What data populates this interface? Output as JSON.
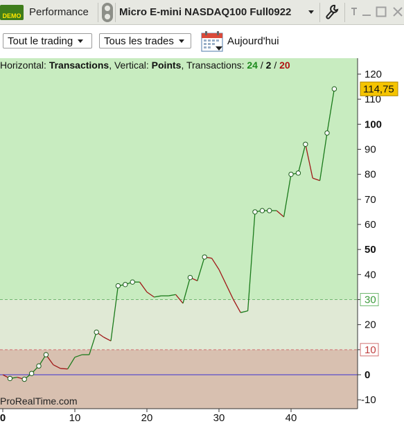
{
  "titlebar": {
    "demo_label": "DEMO",
    "app_name": "Performance",
    "instrument": "Micro E-mini NASDAQ100 Full0922"
  },
  "toolbar": {
    "filter1": "Tout le trading",
    "filter2": "Tous les trades",
    "date_label": "Aujourd'hui"
  },
  "info": {
    "horizontal_label": "Horizontal:",
    "horizontal_value": "Transactions",
    "vertical_label": ", Vertical:",
    "vertical_value": "Points",
    "transactions_label": ", Transactions:",
    "total": "24",
    "sep1": " / ",
    "losers": "2",
    "sep2": " / ",
    "winners": "20"
  },
  "watermark": "ProRealTime.com",
  "colors": {
    "up_line": "#1a7a1a",
    "down_line": "#a01818",
    "profit_zone": "#c8ecc0",
    "neutral_zone": "#e0e9d5",
    "loss_zone": "#d8c0b0",
    "price_tag": "#f5c400"
  },
  "chart_data": {
    "type": "line",
    "x_ticks": [
      "0",
      "10",
      "20",
      "30",
      "40"
    ],
    "y_ticks": [
      "-10",
      "0",
      "10",
      "20",
      "30",
      "40",
      "50",
      "60",
      "70",
      "80",
      "90",
      "100",
      "110",
      "120"
    ],
    "bold_y_ticks": [
      "0",
      "50",
      "100"
    ],
    "xlim": [
      0,
      49.5
    ],
    "ylim": [
      -13,
      122
    ],
    "threshold_low": 10,
    "threshold_high": 30,
    "zero_line": 0,
    "last_value_label": "114,75",
    "series": [
      {
        "points": [
          {
            "x": 0,
            "y": 0
          },
          {
            "x": 1,
            "y": -1.5,
            "m": true
          },
          {
            "x": 2,
            "y": -1
          },
          {
            "x": 3,
            "y": -1.8,
            "m": true
          },
          {
            "x": 4,
            "y": 0.5,
            "m": true
          },
          {
            "x": 5,
            "y": 3.5,
            "m": true
          },
          {
            "x": 6,
            "y": 8,
            "m": true
          },
          {
            "x": 7,
            "y": 4
          },
          {
            "x": 8,
            "y": 2.5
          },
          {
            "x": 9,
            "y": 2.3
          },
          {
            "x": 10,
            "y": 7
          },
          {
            "x": 11,
            "y": 8
          },
          {
            "x": 12,
            "y": 8
          },
          {
            "x": 13,
            "y": 17,
            "m": true
          },
          {
            "x": 14,
            "y": 15
          },
          {
            "x": 15,
            "y": 13.5
          },
          {
            "x": 16,
            "y": 35.5,
            "m": true
          },
          {
            "x": 17,
            "y": 36,
            "m": true
          },
          {
            "x": 18,
            "y": 37,
            "m": true
          },
          {
            "x": 19,
            "y": 37
          },
          {
            "x": 20,
            "y": 33
          },
          {
            "x": 21,
            "y": 31
          },
          {
            "x": 22,
            "y": 31.5
          },
          {
            "x": 23,
            "y": 31.5
          },
          {
            "x": 24,
            "y": 32
          },
          {
            "x": 25,
            "y": 28.5
          },
          {
            "x": 26,
            "y": 38.8,
            "m": true
          },
          {
            "x": 27,
            "y": 37.5
          },
          {
            "x": 28,
            "y": 47,
            "m": true
          },
          {
            "x": 29,
            "y": 46.5
          },
          {
            "x": 30,
            "y": 42
          },
          {
            "x": 31,
            "y": 36
          },
          {
            "x": 32,
            "y": 30
          },
          {
            "x": 33,
            "y": 24.8
          },
          {
            "x": 34,
            "y": 25.5
          },
          {
            "x": 35,
            "y": 65,
            "m": true
          },
          {
            "x": 36,
            "y": 65.5,
            "m": true
          },
          {
            "x": 37,
            "y": 65.5,
            "m": true
          },
          {
            "x": 38,
            "y": 65.5
          },
          {
            "x": 39,
            "y": 63
          },
          {
            "x": 40,
            "y": 80,
            "m": true
          },
          {
            "x": 41,
            "y": 80.5,
            "m": true
          },
          {
            "x": 42,
            "y": 92,
            "m": true
          },
          {
            "x": 43,
            "y": 78.5
          },
          {
            "x": 44,
            "y": 77.5
          },
          {
            "x": 45,
            "y": 96.5,
            "m": true
          },
          {
            "x": 46,
            "y": 114.1,
            "m": true
          }
        ]
      }
    ]
  }
}
